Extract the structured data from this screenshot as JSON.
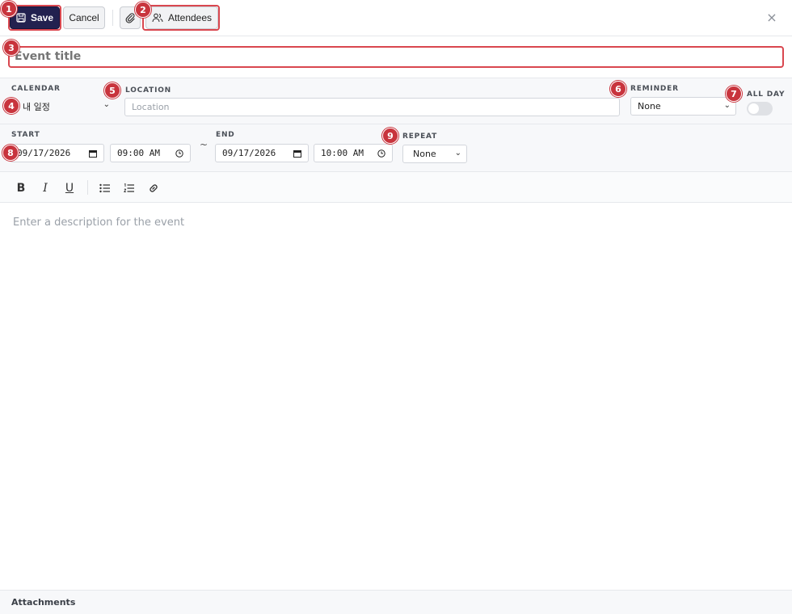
{
  "toolbar": {
    "save_label": "Save",
    "cancel_label": "Cancel",
    "attendees_label": "Attendees",
    "close_glyph": "×"
  },
  "title": {
    "placeholder": "Event title"
  },
  "fields": {
    "calendar_label": "CALENDAR",
    "calendar_value": "내 일정",
    "location_label": "LOCATION",
    "location_placeholder": "Location",
    "reminder_label": "REMINDER",
    "reminder_value": "None",
    "allday_label": "ALL DAY",
    "allday_on": false,
    "start_label": "START",
    "start_date": "09/17/2026",
    "start_time": "09:00 AM",
    "range_sep": "~",
    "end_label": "END",
    "end_date": "09/17/2026",
    "end_time": "10:00 AM",
    "repeat_label": "REPEAT",
    "repeat_value": "None"
  },
  "editor": {
    "tools": [
      "bold-icon",
      "italic-icon",
      "underline-icon",
      "bullet-list-icon",
      "numbered-list-icon",
      "link-icon"
    ],
    "bold_glyph": "B",
    "italic_glyph": "I",
    "underline_glyph": "U",
    "placeholder": "Enter a description for the event"
  },
  "attachments": {
    "label": "Attachments"
  },
  "annotations": [
    "1",
    "2",
    "3",
    "4",
    "5",
    "6",
    "7",
    "8",
    "9"
  ],
  "colors": {
    "primary": "#22214f",
    "highlight": "#d9474f",
    "badge": "#c8343d"
  }
}
